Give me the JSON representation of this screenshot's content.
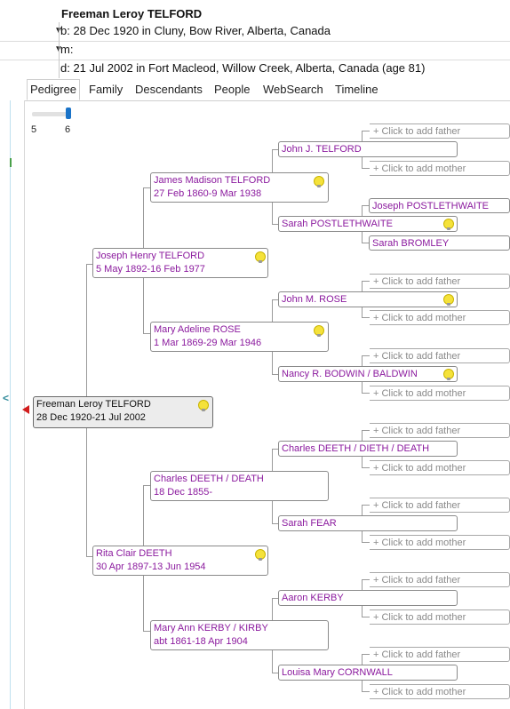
{
  "header": {
    "name": "Freeman Leroy TELFORD",
    "birth": "b: 28 Dec 1920 in Cluny, Bow River, Alberta, Canada",
    "marriage": "m:",
    "death": "d: 21 Jul 2002 in Fort Macleod, Willow Creek, Alberta, Canada (age 81)"
  },
  "tabs": [
    "Pedigree",
    "Family",
    "Descendants",
    "People",
    "WebSearch",
    "Timeline"
  ],
  "active_tab": "Pedigree",
  "generations": {
    "min_label": "5",
    "max_label": "6",
    "value": 6
  },
  "add_father": "+ Click to add father",
  "add_mother": "+ Click to add mother",
  "people": {
    "root": {
      "name": "Freeman Leroy TELFORD",
      "dates": "28 Dec 1920-21 Jul 2002"
    },
    "father": {
      "name": "Joseph Henry TELFORD",
      "dates": "5 May 1892-16 Feb 1977"
    },
    "mother": {
      "name": "Rita Clair DEETH",
      "dates": "30 Apr 1897-13 Jun 1954"
    },
    "pat_grandfather": {
      "name": "James Madison TELFORD",
      "dates": "27 Feb 1860-9 Mar 1938"
    },
    "pat_grandmother": {
      "name": "Mary Adeline ROSE",
      "dates": "1 Mar 1869-29 Mar 1946"
    },
    "mat_grandfather": {
      "name": "Charles DEETH / DEATH",
      "dates": "18 Dec 1855-"
    },
    "mat_grandmother": {
      "name": "Mary Ann KERBY / KIRBY",
      "dates": "abt 1861-18 Apr 1904"
    },
    "g1": {
      "name": "John J. TELFORD"
    },
    "g2": {
      "name": "Sarah POSTLETHWAITE"
    },
    "g3": {
      "name": "John M. ROSE"
    },
    "g4": {
      "name": "Nancy R. BODWIN / BALDWIN"
    },
    "g5": {
      "name": "Charles DEETH / DIETH / DEATH"
    },
    "g6": {
      "name": "Sarah FEAR"
    },
    "g7": {
      "name": "Aaron KERBY"
    },
    "g8": {
      "name": "Louisa Mary CORNWALL"
    },
    "g2_father": {
      "name": "Joseph POSTLETHWAITE"
    },
    "g2_mother": {
      "name": "Sarah BROMLEY"
    }
  }
}
